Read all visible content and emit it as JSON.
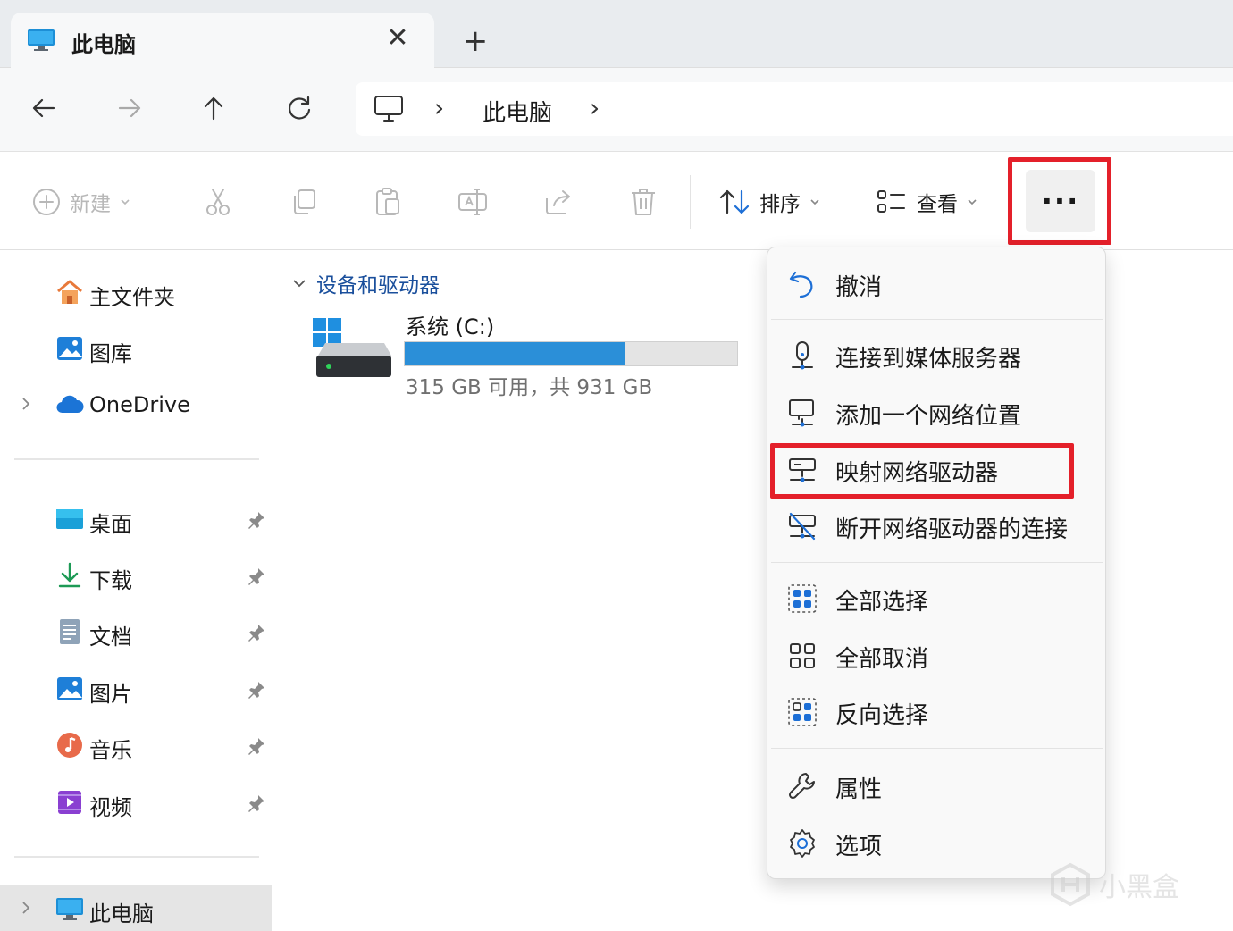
{
  "tab": {
    "title": "此电脑",
    "close_glyph": "✕",
    "new_tab_glyph": "+",
    "icon": "computer-icon"
  },
  "nav": {
    "back_icon": "arrow-left-icon",
    "forward_icon": "arrow-right-icon",
    "up_icon": "arrow-up-icon",
    "refresh_icon": "refresh-icon",
    "address": {
      "crumb": "此电脑",
      "sep": "›"
    }
  },
  "commands": {
    "new_label": "新建",
    "sort_label": "排序",
    "view_label": "查看",
    "more_label": "···"
  },
  "sidebar": {
    "quick": [
      {
        "label": "主文件夹",
        "icon": "home-icon"
      },
      {
        "label": "图库",
        "icon": "gallery-icon"
      },
      {
        "label": "OneDrive",
        "icon": "onedrive-icon"
      }
    ],
    "pinned": [
      {
        "label": "桌面",
        "icon": "desktop-icon"
      },
      {
        "label": "下载",
        "icon": "download-icon"
      },
      {
        "label": "文档",
        "icon": "document-icon"
      },
      {
        "label": "图片",
        "icon": "pictures-icon"
      },
      {
        "label": "音乐",
        "icon": "music-icon"
      },
      {
        "label": "视频",
        "icon": "video-icon"
      }
    ],
    "this_pc": {
      "label": "此电脑",
      "icon": "computer-icon"
    }
  },
  "main": {
    "group_title": "设备和驱动器",
    "drive": {
      "name": "系统 (C:)",
      "free_text": "315 GB 可用，共 931 GB",
      "used_fraction": 0.66,
      "bar_color": "#2b8fd8"
    }
  },
  "menu": {
    "items": [
      {
        "label": "撤消",
        "icon": "undo-icon"
      },
      {
        "label": "连接到媒体服务器",
        "icon": "media-server-icon"
      },
      {
        "label": "添加一个网络位置",
        "icon": "network-location-icon"
      },
      {
        "label": "映射网络驱动器",
        "icon": "map-network-drive-icon"
      },
      {
        "label": "断开网络驱动器的连接",
        "icon": "disconnect-network-drive-icon"
      },
      {
        "label": "全部选择",
        "icon": "select-all-icon"
      },
      {
        "label": "全部取消",
        "icon": "select-none-icon"
      },
      {
        "label": "反向选择",
        "icon": "invert-selection-icon"
      },
      {
        "label": "属性",
        "icon": "properties-icon"
      },
      {
        "label": "选项",
        "icon": "options-icon"
      }
    ]
  },
  "watermark": {
    "text": "小黑盒"
  },
  "colors": {
    "highlight": "#e4202a",
    "accent": "#2b8fd8",
    "group_title": "#1a4f9c"
  }
}
